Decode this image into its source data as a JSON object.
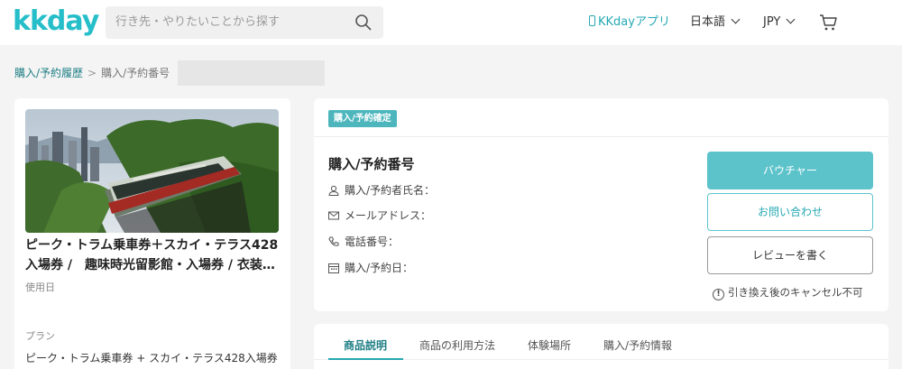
{
  "header": {
    "logo": "kkday",
    "search_placeholder": "行き先・やりたいことから探す",
    "app_label": "KKdayアプリ",
    "language": "日本語",
    "currency": "JPY"
  },
  "breadcrumb": {
    "history": "購入/予約履歴",
    "separator": ">",
    "current": "購入/予約番号"
  },
  "product": {
    "title": "ピーク・トラム乗車券＋スカイ・テラス428入場券 /　趣味時光留影館・入場券 / 衣装…",
    "use_date_label": "使用日",
    "plan_label": "プラン",
    "plan_value": "ピーク・トラム乗車券 + スカイ・テラス428入場券"
  },
  "booking": {
    "status_badge": "購入/予約確定",
    "title": "購入/予約番号",
    "rows": [
      {
        "icon": "user-icon",
        "label": "購入/予約者氏名："
      },
      {
        "icon": "mail-icon",
        "label": "メールアドレス："
      },
      {
        "icon": "phone-icon",
        "label": "電話番号："
      },
      {
        "icon": "calendar-icon",
        "label": "購入/予約日："
      }
    ],
    "voucher_button": "バウチャー",
    "contact_button": "お問い合わせ",
    "review_button": "レビューを書く",
    "notice": "引き換え後のキャンセル不可"
  },
  "tabs": [
    {
      "label": "商品説明",
      "active": true
    },
    {
      "label": "商品の利用方法",
      "active": false
    },
    {
      "label": "体験場所",
      "active": false
    },
    {
      "label": "購入/予約情報",
      "active": false
    }
  ],
  "colors": {
    "brand": "#26bec9",
    "button_primary": "#5cc3cb",
    "badge": "#4db6bd",
    "link": "#1f7f86"
  }
}
